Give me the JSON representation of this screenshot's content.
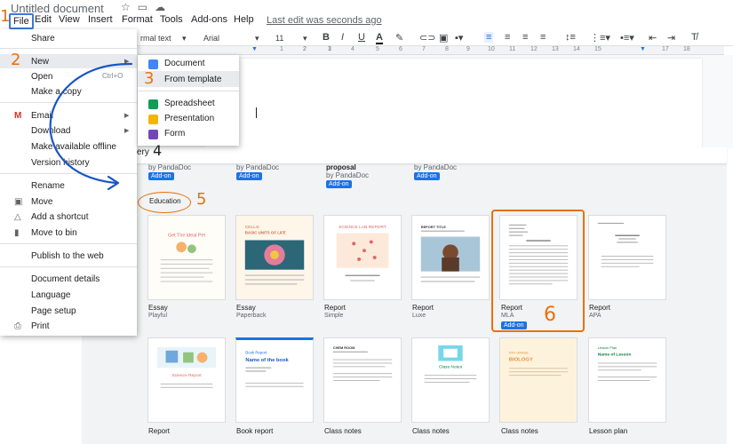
{
  "titlebar": {
    "doc_title": "Untitled document",
    "star_icon": "star-icon",
    "folder_icon": "folder-icon",
    "cloud_icon": "cloud-icon"
  },
  "menubar": {
    "items": [
      "File",
      "Edit",
      "View",
      "Insert",
      "Format",
      "Tools",
      "Add-ons",
      "Help"
    ],
    "last_edit": "Last edit was seconds ago"
  },
  "toolbar": {
    "style": "rmal text",
    "font": "Arial",
    "size": "11",
    "bold": "B",
    "italic": "I",
    "underline": "U",
    "text_color": "A"
  },
  "ruler": {
    "marks": [
      "2",
      "1",
      "1",
      "2",
      "3",
      "4",
      "5",
      "6",
      "7",
      "8",
      "9",
      "10",
      "11",
      "12",
      "13",
      "14",
      "15",
      "16",
      "17",
      "18"
    ]
  },
  "file_menu": {
    "share": "Share",
    "new": "New",
    "open": "Open",
    "make_copy": "Make a copy",
    "email": "Email",
    "download": "Download",
    "make_available": "Make available offline",
    "version_history": "Version history",
    "rename": "Rename",
    "move": "Move",
    "add_shortcut": "Add a shortcut",
    "move_to_bin": "Move to bin",
    "publish": "Publish to the web",
    "doc_details": "Document details",
    "language": "Language",
    "page_setup": "Page setup",
    "print": "Print",
    "open_shortcut": "Ctrl+O"
  },
  "new_submenu": {
    "document": "Document",
    "from_template": "From template",
    "spreadsheet": "Spreadsheet",
    "presentation": "Presentation",
    "form": "Form"
  },
  "gallery": {
    "title": "Template gallery",
    "top_row": [
      {
        "name": "",
        "by": "by PandaDoc",
        "badge": "Add-on"
      },
      {
        "name": "",
        "by": "by PandaDoc",
        "badge": "Add-on"
      },
      {
        "name": "proposal",
        "by": "by PandaDoc",
        "badge": "Add-on"
      },
      {
        "name": "",
        "by": "by PandaDoc",
        "badge": "Add-on"
      }
    ],
    "section": "Education",
    "cards_row1": [
      {
        "label": "Essay",
        "sub": "Playful",
        "thumb_title": "Get The Ideal Pet"
      },
      {
        "label": "Essay",
        "sub": "Paperback",
        "thumb_title": "BASIC UNITS OF LIFE",
        "thumb_kicker": "CELLS:"
      },
      {
        "label": "Report",
        "sub": "Simple",
        "thumb_title": "SCIENCE LAB REPORT"
      },
      {
        "label": "Report",
        "sub": "Luxe",
        "thumb_title": "REPORT TITLE"
      },
      {
        "label": "Report",
        "sub": "MLA",
        "badge": "Add-on"
      },
      {
        "label": "Report",
        "sub": "APA"
      }
    ],
    "cards_row2": [
      {
        "label": "Report",
        "thumb_title": "Science Report"
      },
      {
        "label": "Book report",
        "thumb_kicker": "Book Report",
        "thumb_title": "Name of the book"
      },
      {
        "label": "Class notes",
        "thumb_title": "CHEM ROOM"
      },
      {
        "label": "Class notes",
        "thumb_title": "Class Notes"
      },
      {
        "label": "Class notes",
        "thumb_title": "BIOLOGY",
        "thumb_kicker": "9TH GRADE"
      },
      {
        "label": "Lesson plan",
        "thumb_title": "Name of Lesson",
        "thumb_kicker": "Lesson Plan"
      }
    ]
  },
  "annotations": [
    "1",
    "2",
    "3",
    "4",
    "5",
    "6"
  ],
  "colors": {
    "accent": "#1a73e8",
    "annotation": "#e8710a",
    "arrow": "#1a56c4",
    "docs_blue": "#4285f4",
    "sheets_green": "#0f9d58",
    "slides_yellow": "#f4b400",
    "forms_purple": "#7248b9"
  }
}
